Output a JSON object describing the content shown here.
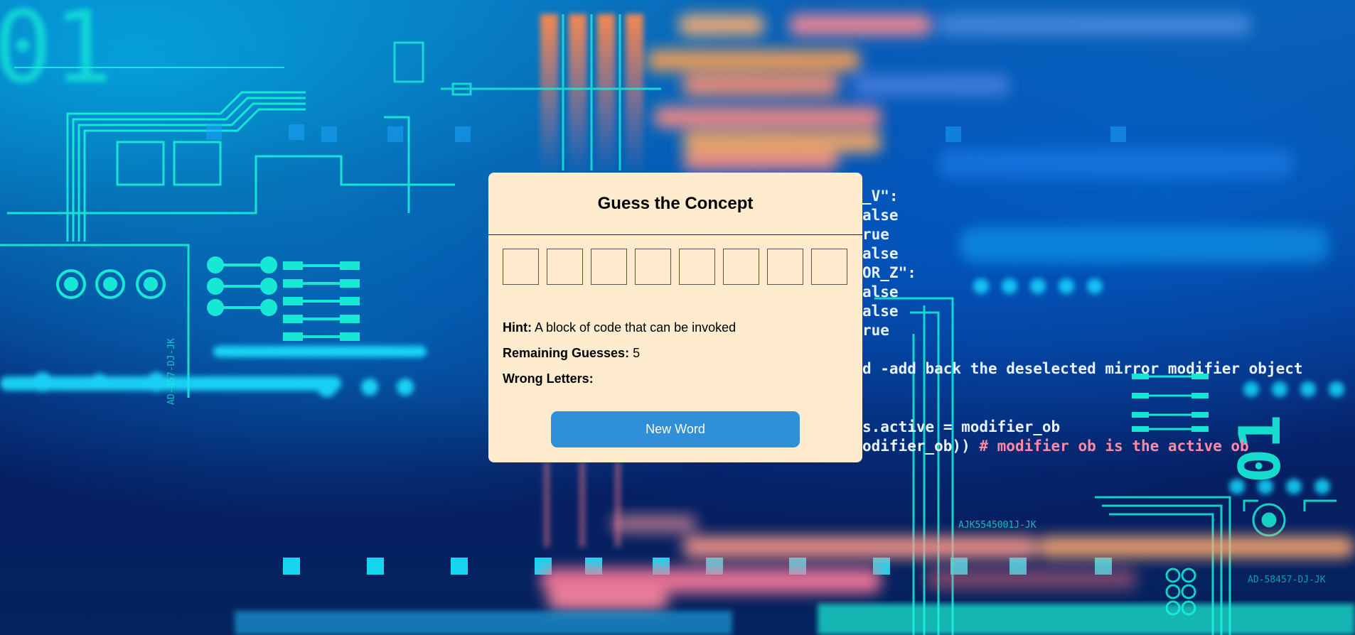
{
  "game": {
    "title": "Guess the Concept",
    "slot_count": 8,
    "hint_label": "Hint:",
    "hint_text": "A block of code that can be invoked",
    "remaining_label": "Remaining Guesses:",
    "remaining_value": "5",
    "wrong_label": "Wrong Letters:",
    "wrong_value": "",
    "new_word_label": "New Word"
  },
  "background": {
    "code_lines": [
      "_V\":",
      "alse",
      "rue",
      "alse",
      "OR_Z\":",
      "alse",
      "alse",
      "rue",
      "d -add back the deselected mirror modifier object",
      "s.active = modifier_ob",
      "odifier_ob)) # modifier ob is the active ob"
    ],
    "labels": [
      "AJK5545001J-JK",
      "AD-58457-DJ-JK",
      "AD-457-DJ-JK"
    ],
    "digits": [
      "01",
      "01"
    ],
    "colors": {
      "cyan": "#19f0d8",
      "code_text": "#e8f2ff",
      "code_orange": "#ff9a55",
      "code_pink": "#ff8aa8"
    }
  }
}
